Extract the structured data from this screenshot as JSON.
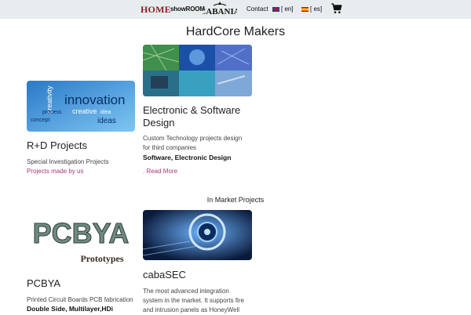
{
  "nav": {
    "home": "HOME",
    "showroom": "showROOM",
    "logo_text": "CABANIA",
    "contact": "Contact",
    "lang_en": "[ en]",
    "lang_es": "[ es]"
  },
  "title": "HardCore Makers",
  "cards": {
    "rd": {
      "thumb_words": [
        "innovation",
        "creativity",
        "process",
        "creative",
        "ideas",
        "concept",
        "idea"
      ],
      "title": "R+D Projects",
      "desc": "Special Investigation Projects",
      "link": "Projects made by us"
    },
    "esd": {
      "title_line1": "Electronic & Software",
      "title_line2": "Design",
      "desc_line1": "Custom Technology projects design",
      "desc_line2": "for third companies",
      "tags": "Software, Electronic Design",
      "link": ". Read More"
    },
    "pcbya": {
      "logo_text": "PCBYA",
      "logo_sub": "Prototypes",
      "title": "PCBYA",
      "desc": "Printed Circuit Boards PCB fabrication",
      "tags": "Double Side, Multilayer,HDi"
    },
    "cabasec": {
      "title": "cabaSEC",
      "desc_line1": "The most advanced integration",
      "desc_line2": "system in the market. It supports fire",
      "desc_line3": "and intrusion panels as HoneyWell"
    }
  },
  "section_market": "In Market Projects",
  "colors": {
    "topbar": "#e7ecef",
    "home": "#8b1e24",
    "link": "#a23a7a"
  }
}
